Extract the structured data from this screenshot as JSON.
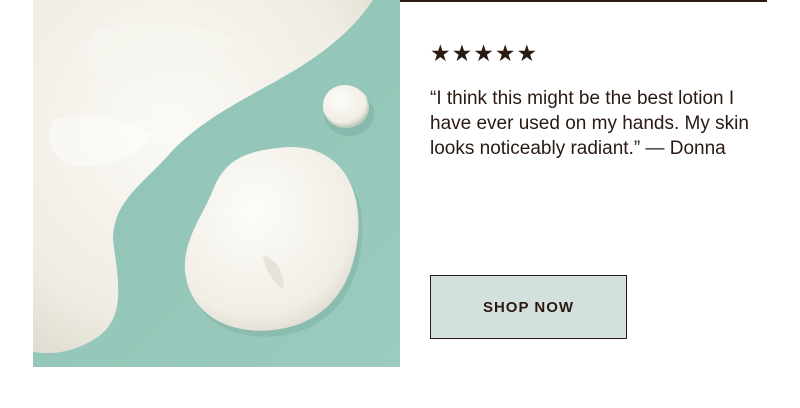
{
  "review": {
    "stars": "★★★★★",
    "quote": "“I think this might be the best lotion I have ever used on my hands. My skin looks noticeably radiant.” — Donna"
  },
  "cta": {
    "label": "SHOP NOW"
  },
  "colors": {
    "accent_text": "#2a1a12",
    "cta_background": "#d3e0dc",
    "image_background": "#8fc3b5"
  }
}
